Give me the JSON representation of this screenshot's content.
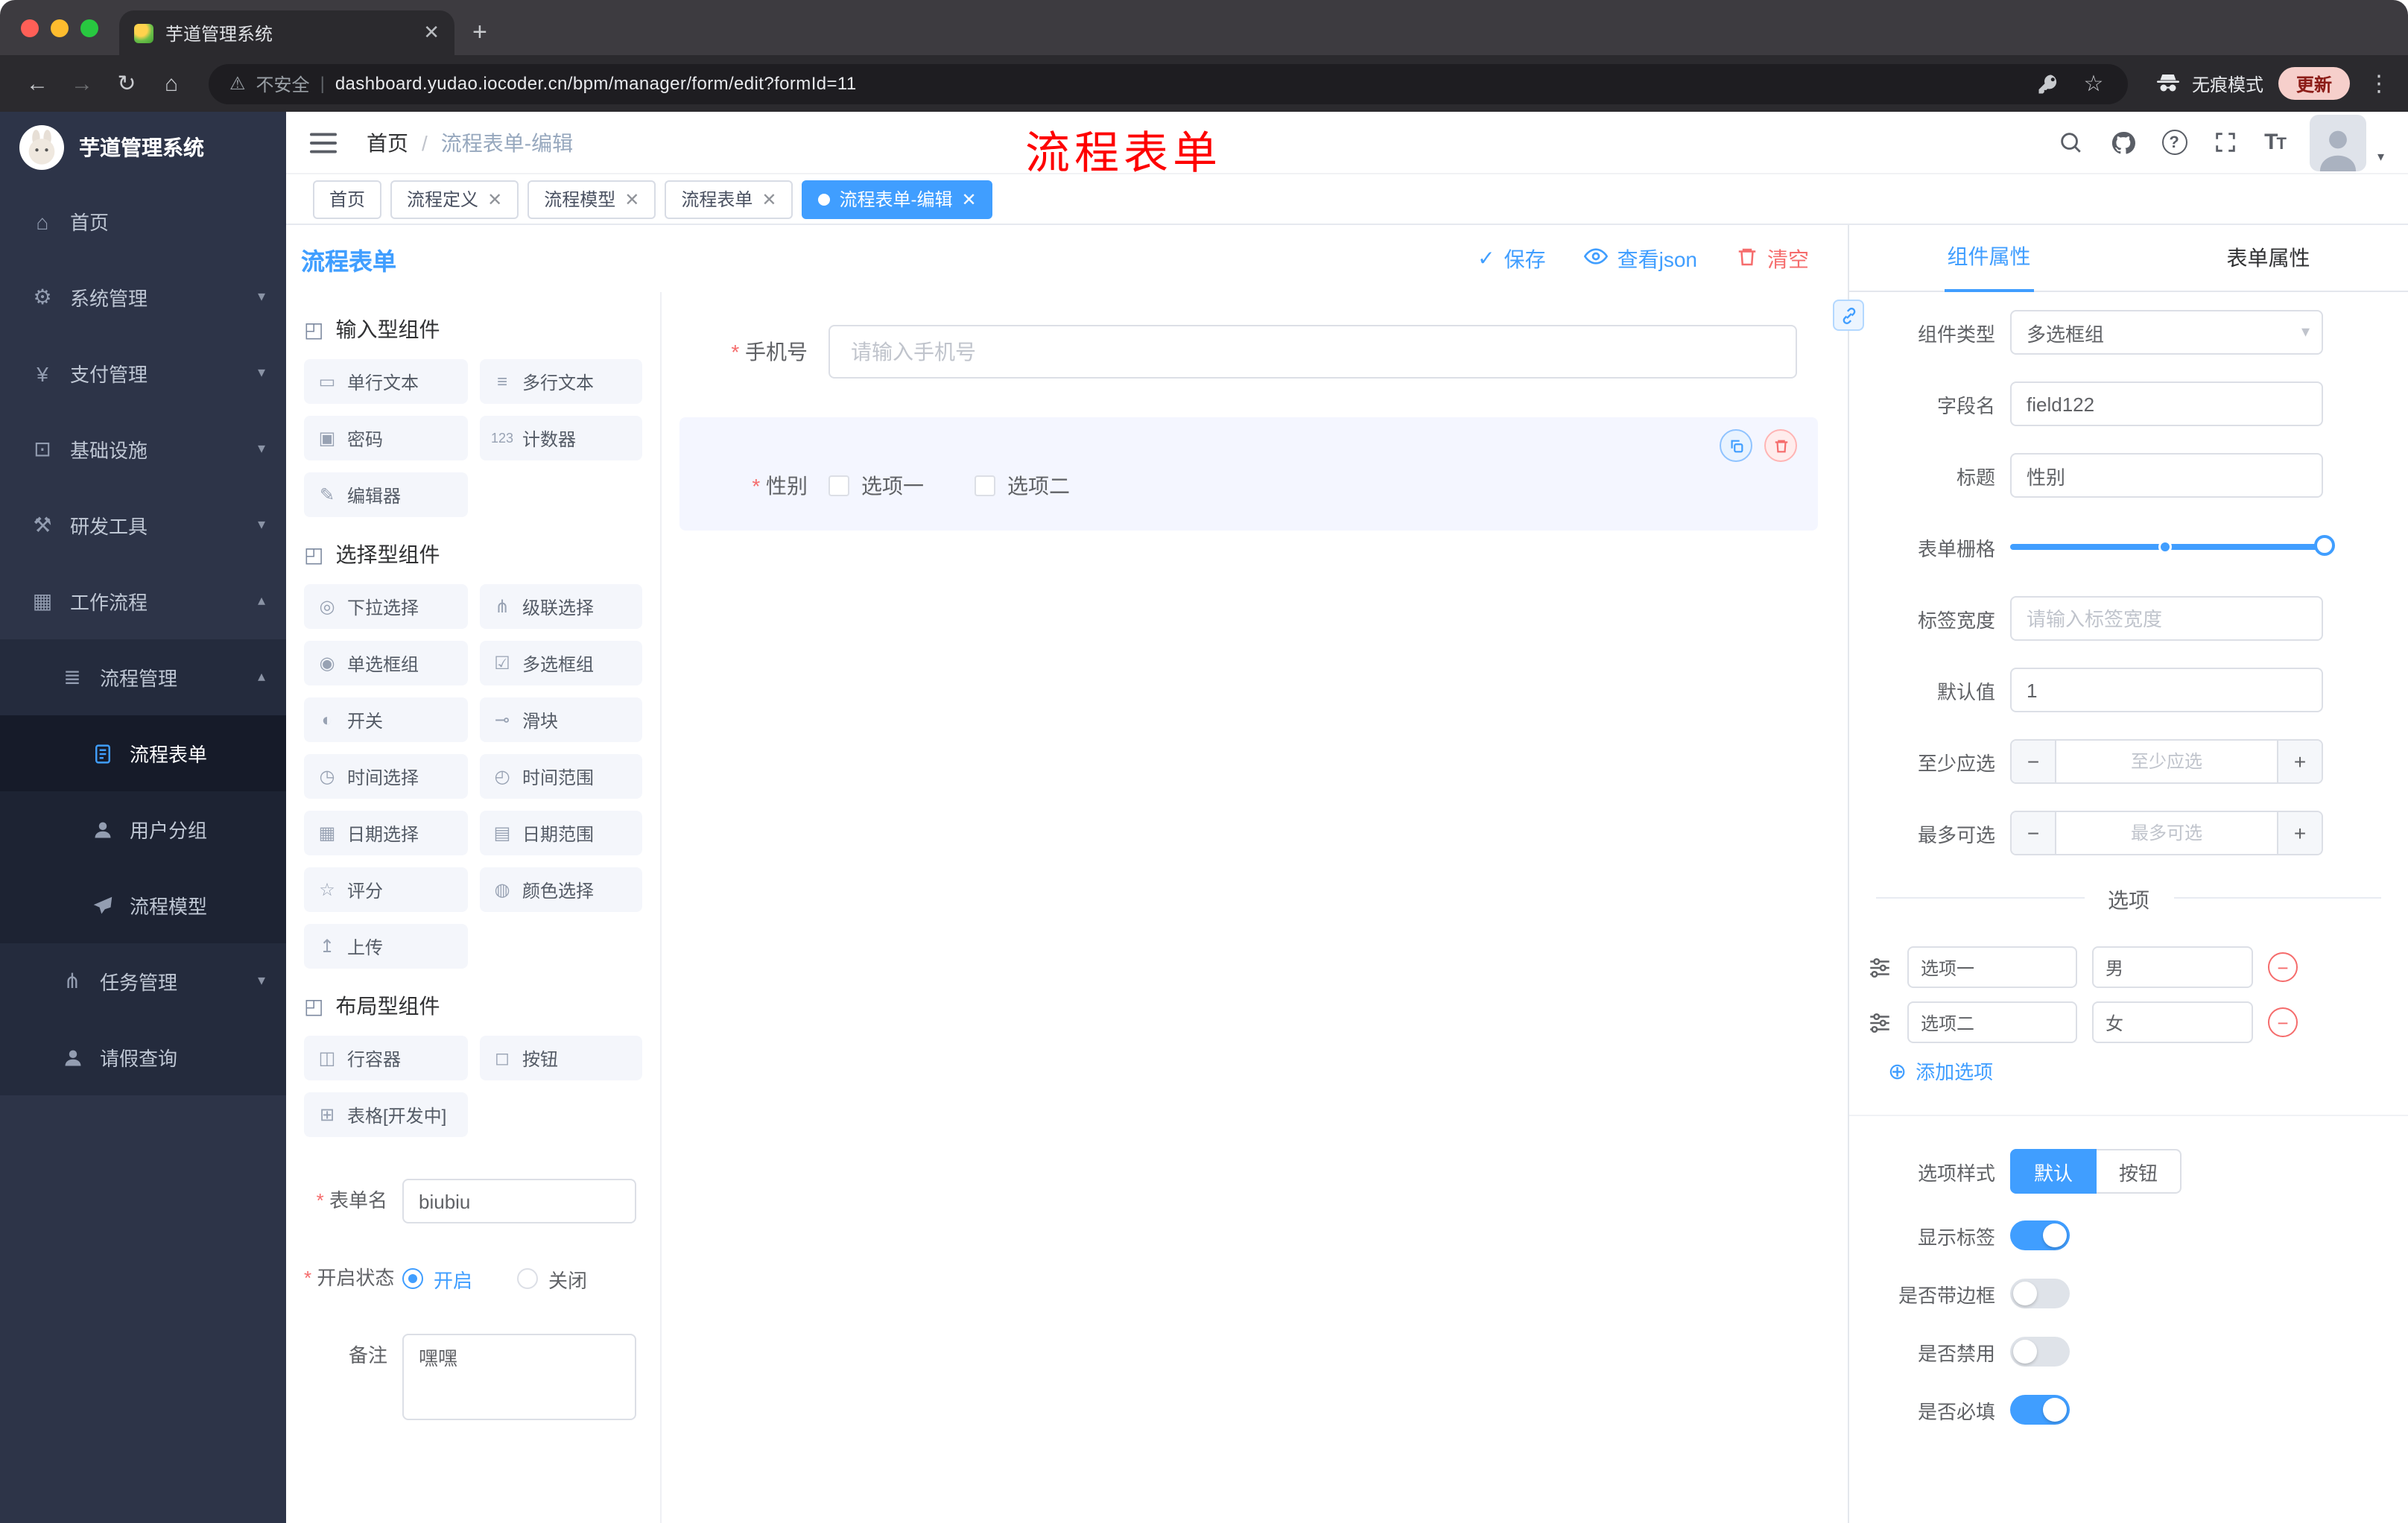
{
  "browser": {
    "tab_title": "芋道管理系统",
    "security_label": "不安全",
    "url": "dashboard.yudao.iocoder.cn/bpm/manager/form/edit?formId=11",
    "incognito_label": "无痕模式",
    "update_label": "更新"
  },
  "sidebar": {
    "app_title": "芋道管理系统",
    "items": [
      {
        "label": "首页",
        "icon": "dashboard-icon"
      },
      {
        "label": "系统管理",
        "icon": "gear-icon"
      },
      {
        "label": "支付管理",
        "icon": "payment-icon"
      },
      {
        "label": "基础设施",
        "icon": "infrastructure-icon"
      },
      {
        "label": "研发工具",
        "icon": "tools-icon"
      },
      {
        "label": "工作流程",
        "icon": "workflow-icon"
      },
      {
        "label": "流程管理",
        "icon": "process-management-icon"
      },
      {
        "label": "流程表单",
        "icon": "form-icon",
        "active": true
      },
      {
        "label": "用户分组",
        "icon": "user-group-icon"
      },
      {
        "label": "流程模型",
        "icon": "process-model-icon"
      },
      {
        "label": "任务管理",
        "icon": "task-management-icon"
      },
      {
        "label": "请假查询",
        "icon": "leave-query-icon"
      }
    ]
  },
  "header": {
    "breadcrumb_home": "首页",
    "breadcrumb_current": "流程表单-编辑",
    "annotation": "流程表单"
  },
  "tags": [
    {
      "label": "首页",
      "closable": false,
      "active": false
    },
    {
      "label": "流程定义",
      "closable": true,
      "active": false
    },
    {
      "label": "流程模型",
      "closable": true,
      "active": false
    },
    {
      "label": "流程表单",
      "closable": true,
      "active": false
    },
    {
      "label": "流程表单-编辑",
      "closable": true,
      "active": true
    }
  ],
  "designer": {
    "title": "流程表单",
    "save": "保存",
    "view_json": "查看json",
    "clear": "清空"
  },
  "library": {
    "group_input": "输入型组件",
    "group_select": "选择型组件",
    "group_layout": "布局型组件",
    "input_chips": [
      {
        "label": "单行文本",
        "icon": "single-line-text-icon"
      },
      {
        "label": "多行文本",
        "icon": "multi-line-text-icon"
      },
      {
        "label": "密码",
        "icon": "password-icon"
      },
      {
        "label": "计数器",
        "icon": "counter-icon"
      },
      {
        "label": "编辑器",
        "icon": "editor-icon"
      }
    ],
    "select_chips": [
      {
        "label": "下拉选择",
        "icon": "dropdown-select-icon"
      },
      {
        "label": "级联选择",
        "icon": "cascade-select-icon"
      },
      {
        "label": "单选框组",
        "icon": "radio-group-icon"
      },
      {
        "label": "多选框组",
        "icon": "checkbox-group-icon"
      },
      {
        "label": "开关",
        "icon": "switch-icon"
      },
      {
        "label": "滑块",
        "icon": "slider-icon"
      },
      {
        "label": "时间选择",
        "icon": "time-picker-icon"
      },
      {
        "label": "时间范围",
        "icon": "time-range-icon"
      },
      {
        "label": "日期选择",
        "icon": "date-picker-icon"
      },
      {
        "label": "日期范围",
        "icon": "date-range-icon"
      },
      {
        "label": "评分",
        "icon": "rating-icon"
      },
      {
        "label": "颜色选择",
        "icon": "color-picker-icon"
      },
      {
        "label": "上传",
        "icon": "upload-icon"
      }
    ],
    "layout_chips": [
      {
        "label": "行容器",
        "icon": "row-container-icon"
      },
      {
        "label": "按钮",
        "icon": "button-icon"
      },
      {
        "label": "表格[开发中]",
        "icon": "table-icon"
      }
    ]
  },
  "meta_form": {
    "name_label": "表单名",
    "name_value": "biubiu",
    "status_label": "开启状态",
    "status_on": "开启",
    "status_off": "关闭",
    "remark_label": "备注",
    "remark_value": "嘿嘿"
  },
  "canvas": {
    "phone_label": "手机号",
    "phone_placeholder": "请输入手机号",
    "gender_label": "性别",
    "gender_option1": "选项一",
    "gender_option2": "选项二"
  },
  "props": {
    "tab_component": "组件属性",
    "tab_form": "表单属性",
    "component_type_label": "组件类型",
    "component_type_value": "多选框组",
    "field_name_label": "字段名",
    "field_name_value": "field122",
    "title_label": "标题",
    "title_value": "性别",
    "grid_label": "表单栅格",
    "label_width_label": "标签宽度",
    "label_width_placeholder": "请输入标签宽度",
    "default_label": "默认值",
    "default_value": "1",
    "min_label": "至少应选",
    "min_placeholder": "至少应选",
    "max_label": "最多可选",
    "max_placeholder": "最多可选",
    "options_title": "选项",
    "options": [
      {
        "name": "选项一",
        "value": "男"
      },
      {
        "name": "选项二",
        "value": "女"
      }
    ],
    "add_option": "添加选项",
    "style_label": "选项样式",
    "style_default": "默认",
    "style_button": "按钮",
    "switches": [
      {
        "label": "显示标签",
        "on": true
      },
      {
        "label": "是否带边框",
        "on": false
      },
      {
        "label": "是否禁用",
        "on": false
      },
      {
        "label": "是否必填",
        "on": true
      }
    ]
  },
  "colors": {
    "accent": "#409eff",
    "danger": "#f56c6c",
    "sidebar": "#2d3448"
  }
}
